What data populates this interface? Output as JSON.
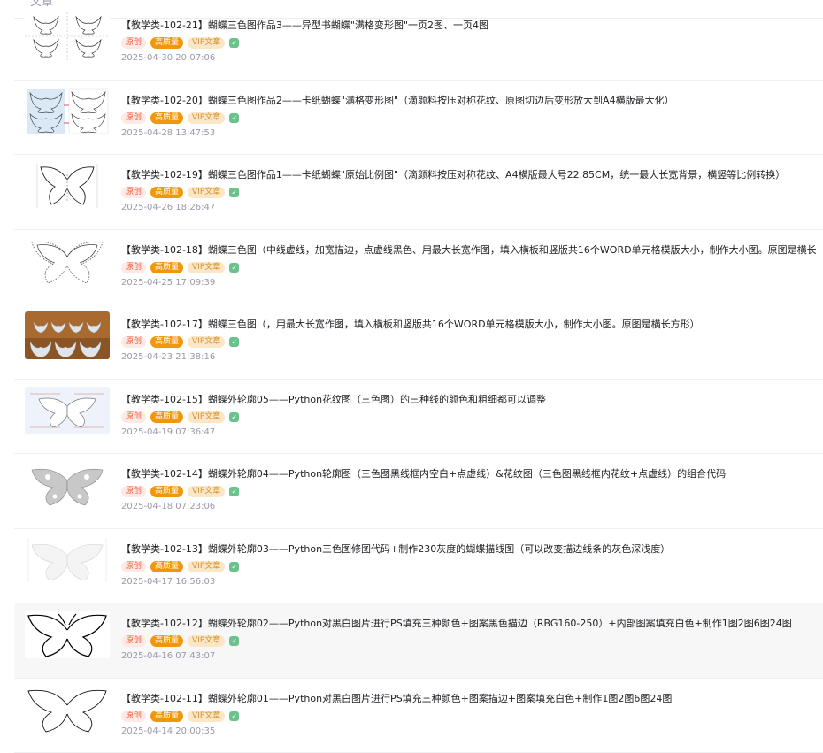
{
  "header": {
    "tab_label": "文章"
  },
  "badges": {
    "original": "原创",
    "quality": "高质量",
    "vip": "VIP文章"
  },
  "articles": [
    {
      "title": "【教学类-102-21】蝴蝶三色图作品3——异型书蝴蝶\"满格变形图\"一页2图、一页4图",
      "date": "2025-04-30 20:07:06",
      "thumb_icon": "butterfly-grid-icon"
    },
    {
      "title": "【教学类-102-20】蝴蝶三色图作品2——卡纸蝴蝶\"满格变形图\"（滴颜料按压对称花纹、原图切边后变形放大到A4横版最大化）",
      "date": "2025-04-28 13:47:53",
      "thumb_icon": "butterfly-compare-icon"
    },
    {
      "title": "【教学类-102-19】蝴蝶三色图作品1——卡纸蝴蝶\"原始比例图\"（滴颜料按压对称花纹、A4横版最大号22.85CM，统一最大长宽背景，横竖等比例转换）",
      "date": "2025-04-26 18:26:47",
      "thumb_icon": "butterfly-outline-icon"
    },
    {
      "title": "【教学类-102-18】蝴蝶三色图（中线虚线，加宽描边，点虚线黑色、用最大长宽作图，填入横板和竖版共16个WORD单元格模版大小，制作大小图。原图是横长",
      "date": "2025-04-25 17:09:39",
      "thumb_icon": "butterfly-dotted-icon"
    },
    {
      "title": "【教学类-102-17】蝴蝶三色图（，用最大长宽作图，填入横板和竖版共16个WORD单元格模版大小，制作大小图。原图是横长方形）",
      "date": "2025-04-23 21:38:16",
      "thumb_icon": "butterfly-photo-icon"
    },
    {
      "title": "【教学类-102-15】蝴蝶外轮廓05——Python花纹图（三色图）的三种线的颜色和粗细都可以调整",
      "date": "2025-04-19 07:36:47",
      "thumb_icon": "butterfly-pattern-icon"
    },
    {
      "title": "【教学类-102-14】蝴蝶外轮廓04——Python轮廓图（三色图黑线框内空白+点虚线）&花纹图（三色图黑线框内花纹+点虚线）的组合代码",
      "date": "2025-04-18 07:23:06",
      "thumb_icon": "butterfly-gray-icon"
    },
    {
      "title": "【教学类-102-13】蝴蝶外轮廓03——Python三色图修图代码+制作230灰度的蝴蝶描线图（可以改变描边线条的灰色深浅度）",
      "date": "2025-04-17 16:56:03",
      "thumb_icon": "butterfly-light-icon"
    },
    {
      "title": "【教学类-102-12】蝴蝶外轮廓02——Python对黑白图片进行PS填充三种颜色+图案黑色描边（RBG160-250）+内部图案填充白色+制作1图2图6图24图",
      "date": "2025-04-16 07:43:07",
      "thumb_icon": "butterfly-black-icon"
    },
    {
      "title": "【教学类-102-11】蝴蝶外轮廓01——Python对黑白图片进行PS填充三种颜色+图案描边+图案填充白色+制作1图2图6图24图",
      "date": "2025-04-14 20:00:35",
      "thumb_icon": "butterfly-black-icon"
    }
  ]
}
